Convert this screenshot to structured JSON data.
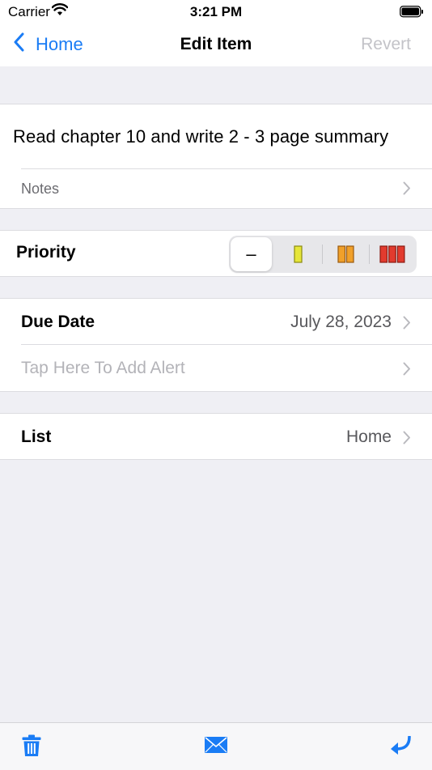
{
  "status_bar": {
    "carrier": "Carrier",
    "time": "3:21 PM"
  },
  "nav": {
    "back_label": "Home",
    "title": "Edit Item",
    "revert_label": "Revert"
  },
  "item": {
    "title": "Read chapter 10 and write 2 - 3 page summary",
    "notes_label": "Notes"
  },
  "priority": {
    "label": "Priority",
    "selected_index": 0,
    "options": [
      {
        "symbol": "–",
        "name": "none"
      },
      {
        "name": "low",
        "color": "#e6e63a"
      },
      {
        "name": "medium",
        "color": "#f0a02a"
      },
      {
        "name": "high",
        "color": "#e23b2e"
      }
    ]
  },
  "due": {
    "label": "Due Date",
    "value": "July 28, 2023",
    "alert_placeholder": "Tap Here To Add Alert"
  },
  "list": {
    "label": "List",
    "value": "Home"
  },
  "toolbar": {
    "icons": [
      "trash-icon",
      "mail-icon",
      "return-icon"
    ]
  },
  "colors": {
    "accent": "#1a7cf5",
    "background": "#efeff4"
  }
}
